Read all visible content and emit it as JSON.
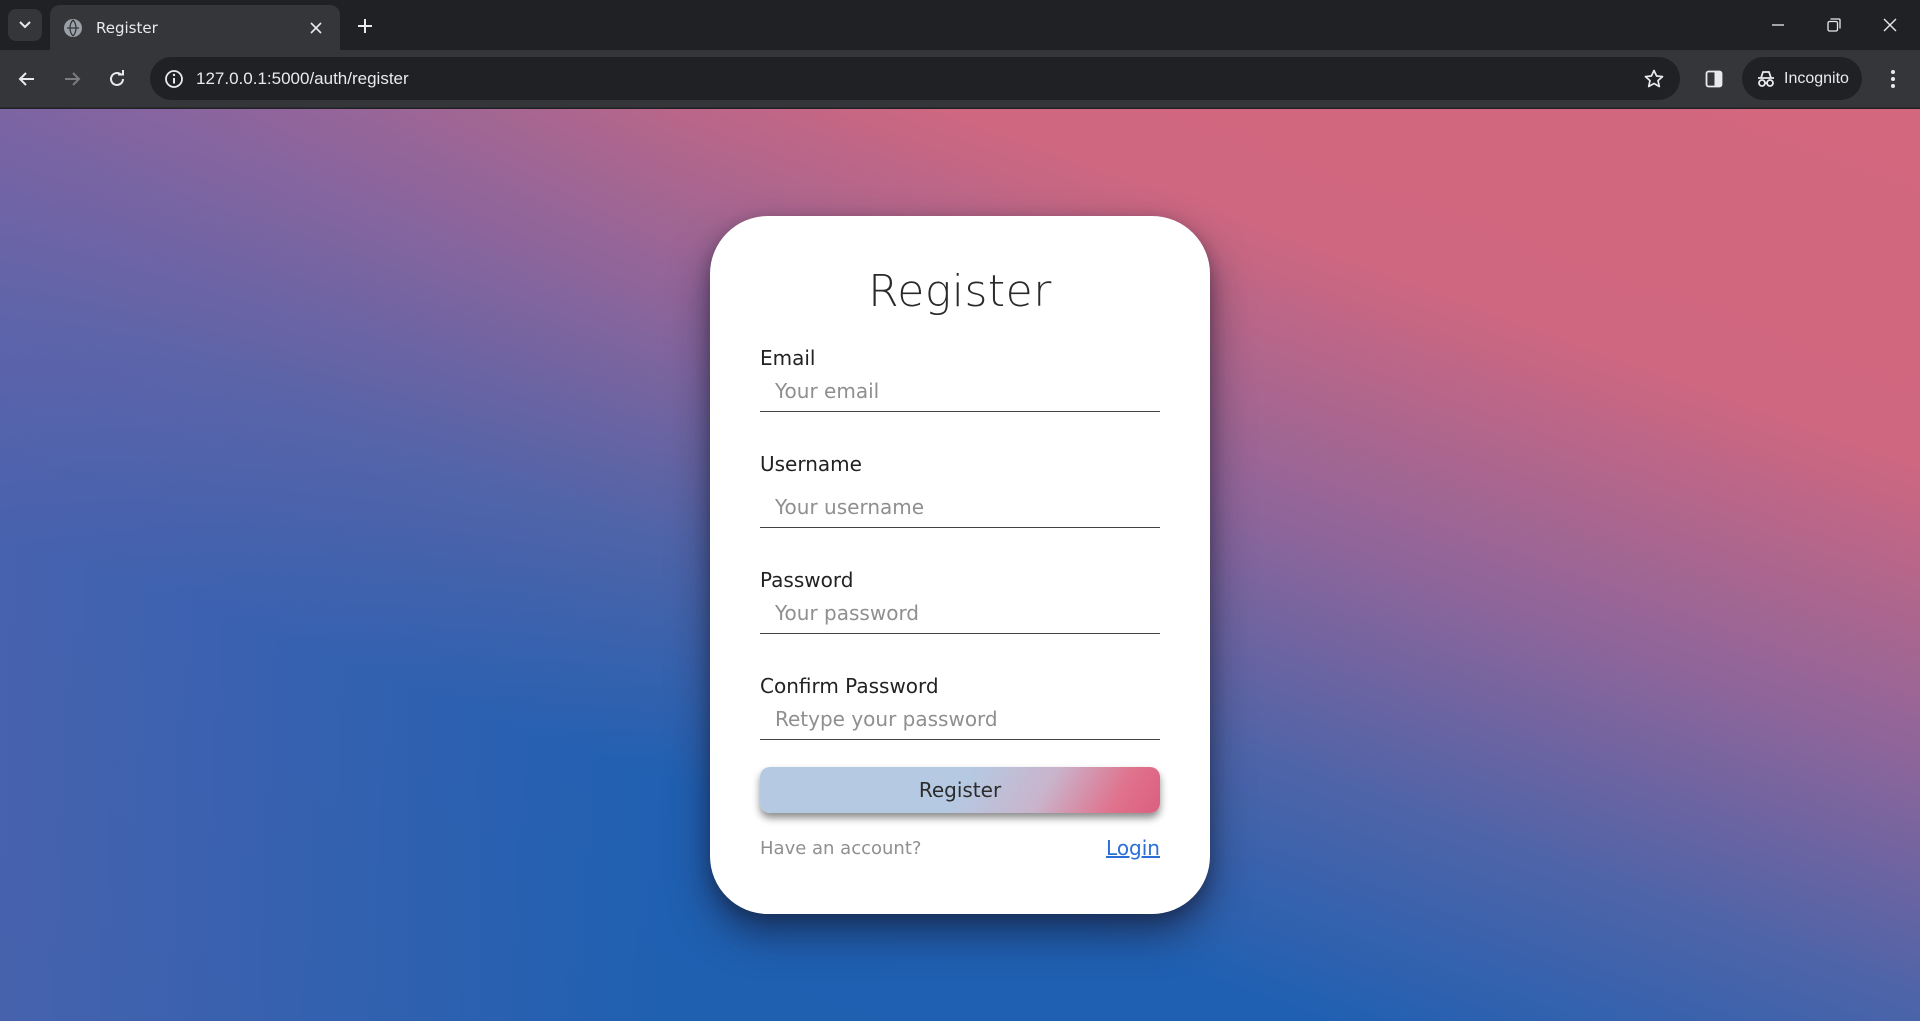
{
  "browser": {
    "tab_title": "Register",
    "url": "127.0.0.1:5000/auth/register",
    "incognito_label": "Incognito",
    "icons": [
      "tab-search-icon",
      "globe-icon",
      "close-icon",
      "plus-icon",
      "minimize-icon",
      "restore-icon",
      "window-close-icon",
      "back-icon",
      "forward-icon",
      "reload-icon",
      "info-icon",
      "star-icon",
      "side-panel-icon",
      "incognito-icon",
      "kebab-menu-icon"
    ]
  },
  "form": {
    "title": "Register",
    "fields": [
      {
        "label": "Email",
        "placeholder": "Your email",
        "value": ""
      },
      {
        "label": "Username",
        "placeholder": "Your username",
        "value": ""
      },
      {
        "label": "Password",
        "placeholder": "Your password",
        "value": ""
      },
      {
        "label": "Confirm Password",
        "placeholder": "Retype your password",
        "value": ""
      }
    ],
    "submit_label": "Register",
    "have_account_text": "Have an account?",
    "login_link": "Login"
  },
  "colors": {
    "gradient_top": "#d2677d",
    "gradient_bottom": "#1e60b0",
    "link": "#2a6fd6",
    "button_light": "#b5c9e2",
    "button_accent": "#db5f80"
  }
}
